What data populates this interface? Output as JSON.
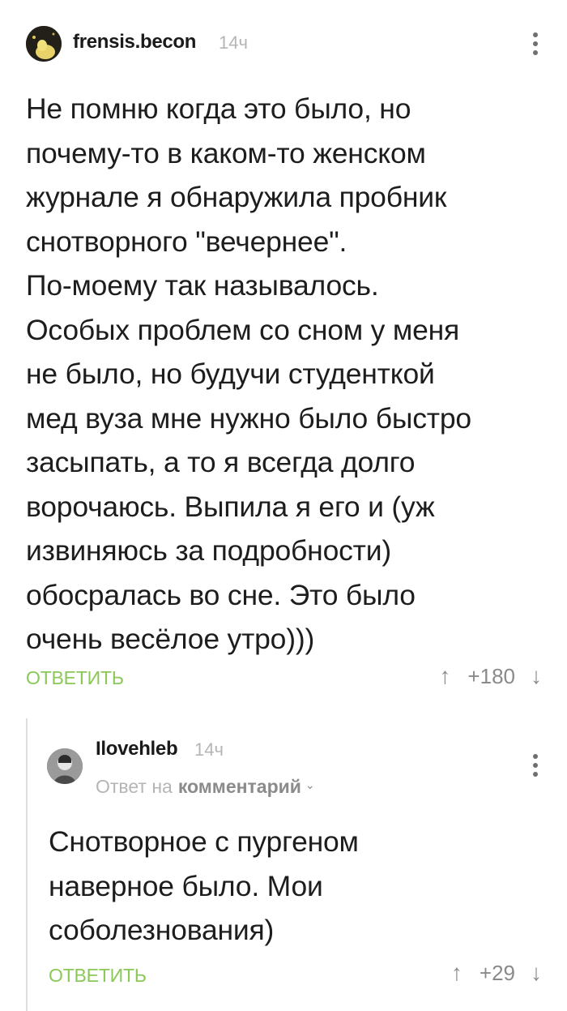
{
  "main_comment": {
    "username": "frensis.becon",
    "time": "14ч",
    "text": "Не помню когда это было, но\nпочему-то в каком-то женском\nжурнале я обнаружила пробник\nснотворного \"вечернее\".\nПо-моему так называлось.\nОсобых проблем со сном у меня\nне было, но будучи студенткой\nмед вуза мне нужно было быстро\nзасыпать, а то я всегда долго\nворочаюсь. Выпила я его и (уж\nизвиняюсь за подробности)\nобосралась во сне. Это было\nочень весёлое утро)))",
    "reply_label": "ОТВЕТИТЬ",
    "rating": "+180",
    "upvote_icon": "arrow-up-icon",
    "downvote_icon": "arrow-down-icon"
  },
  "reply_comment": {
    "username": "Ilovehleb",
    "time": "14ч",
    "reply_prefix": "Ответ на",
    "reply_target": "комментарий",
    "text": "Снотворное с пургеном\nнаверное было. Мои\nсоболезнования)",
    "reply_label": "ОТВЕТИТЬ",
    "rating": "+29"
  },
  "icons": {
    "menu": "more-vertical-icon",
    "chevron": "chevron-down-icon",
    "up": "↑",
    "down": "↓"
  },
  "colors": {
    "accent_green": "#8ac858",
    "muted": "#b5b5b5",
    "text": "#1d1d1d"
  }
}
